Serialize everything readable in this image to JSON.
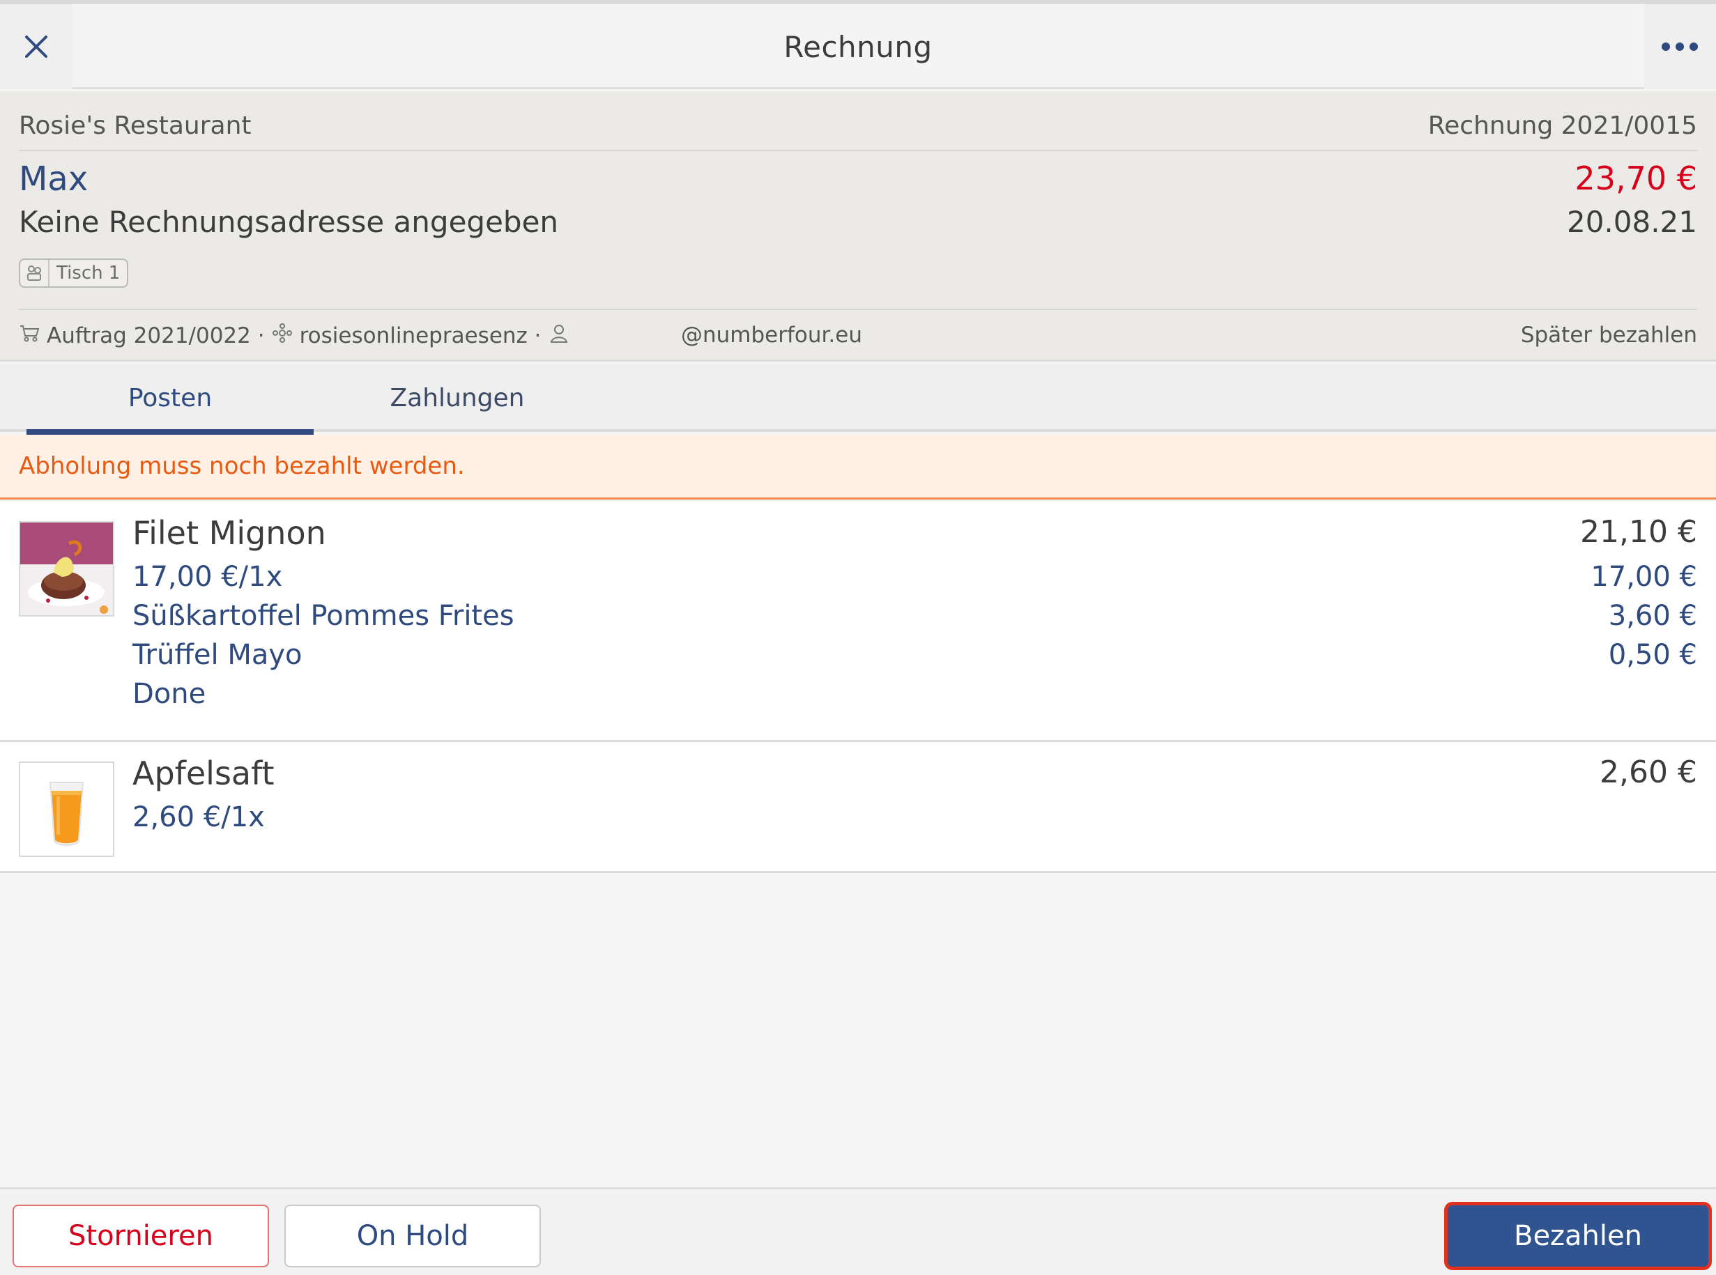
{
  "header": {
    "title": "Rechnung",
    "close_icon": "close-icon",
    "more_icon": "more-icon"
  },
  "invoice": {
    "restaurant": "Rosie's Restaurant",
    "number": "Rechnung 2021/0015",
    "customer": "Max",
    "total": "23,70 €",
    "address": "Keine Rechnungsadresse angegeben",
    "date": "20.08.21",
    "table": "Tisch 1",
    "order": "Auftrag 2021/0022 ·",
    "source": "rosiesonlinepraesenz ·",
    "email": "@numberfour.eu",
    "pay_later": "Später bezahlen",
    "colors": {
      "total": "#d8001a",
      "accent": "#2f4a7e"
    }
  },
  "tabs": [
    {
      "label": "Posten",
      "active": true
    },
    {
      "label": "Zahlungen",
      "active": false
    }
  ],
  "banner": {
    "text": "Abholung muss noch bezahlt werden.",
    "color": "#e85a10"
  },
  "items": [
    {
      "name": "Filet Mignon",
      "price": "21,10 €",
      "image": "steak-dish",
      "lines": [
        {
          "label": "17,00 €/1x",
          "price": "17,00 €"
        },
        {
          "label": "Süßkartoffel Pommes Frites",
          "price": "3,60 €"
        },
        {
          "label": "Trüffel Mayo",
          "price": "0,50 €"
        },
        {
          "label": "Done",
          "price": ""
        }
      ]
    },
    {
      "name": "Apfelsaft",
      "price": "2,60 €",
      "image": "juice-glass",
      "lines": [
        {
          "label": "2,60 €/1x",
          "price": ""
        }
      ]
    }
  ],
  "footer": {
    "cancel": "Stornieren",
    "hold": "On Hold",
    "pay": "Bezahlen"
  }
}
